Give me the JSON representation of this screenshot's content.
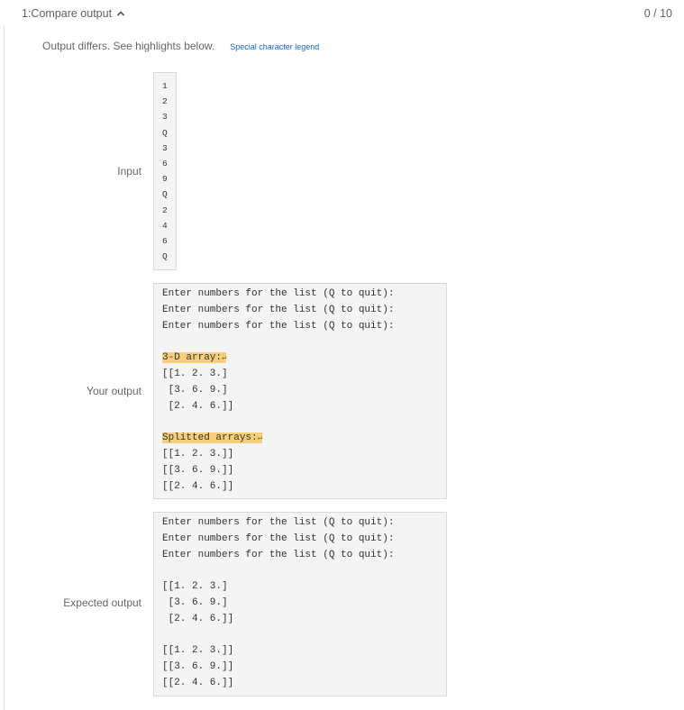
{
  "header": {
    "title": "1:Compare output",
    "score": "0 / 10"
  },
  "status": {
    "message": "Output differs. See highlights below.",
    "legend_link": "Special character legend"
  },
  "labels": {
    "input": "Input",
    "your_output": "Your output",
    "expected_output": "Expected output"
  },
  "input_lines": [
    "1",
    "2",
    "3",
    "Q",
    "3",
    "6",
    "9",
    "Q",
    "2",
    "4",
    "6",
    "Q"
  ],
  "your_output": {
    "prompt_lines": [
      "Enter numbers for the list (Q to quit):",
      "Enter numbers for the list (Q to quit):",
      "Enter numbers for the list (Q to quit):"
    ],
    "header_3d": "3-D array:",
    "array_lines": [
      "[[1. 2. 3.]",
      " [3. 6. 9.]",
      " [2. 4. 6.]]"
    ],
    "header_split": "Splitted arrays:",
    "split_lines": [
      "[[1. 2. 3.]]",
      "[[3. 6. 9.]]",
      "[[2. 4. 6.]]"
    ],
    "newline_marker": "↵"
  },
  "expected_output": {
    "prompt_lines": [
      "Enter numbers for the list (Q to quit):",
      "Enter numbers for the list (Q to quit):",
      "Enter numbers for the list (Q to quit):"
    ],
    "array_lines": [
      "[[1. 2. 3.]",
      " [3. 6. 9.]",
      " [2. 4. 6.]]"
    ],
    "split_lines": [
      "[[1. 2. 3.]]",
      "[[3. 6. 9.]]",
      "[[2. 4. 6.]]"
    ]
  },
  "colors": {
    "highlight": "#f5cf7a",
    "link": "#1565c0",
    "box_background": "#f4f4f4"
  }
}
